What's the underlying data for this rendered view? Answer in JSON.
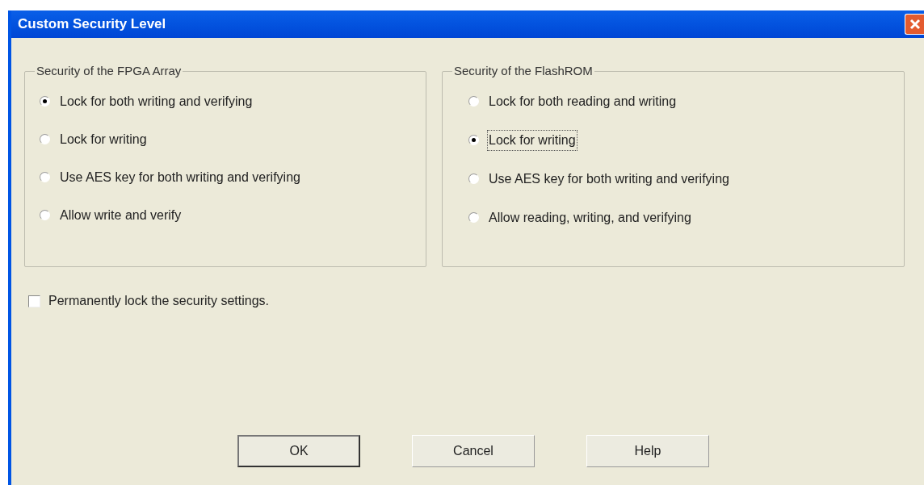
{
  "window": {
    "title": "Custom Security Level"
  },
  "groups": [
    {
      "title": "Security of the FPGA Array",
      "options": [
        {
          "label": "Lock for both writing and verifying",
          "selected": true,
          "focused": false
        },
        {
          "label": "Lock for writing",
          "selected": false,
          "focused": false
        },
        {
          "label": "Use AES key for both writing and verifying",
          "selected": false,
          "focused": false
        },
        {
          "label": "Allow write and verify",
          "selected": false,
          "focused": false
        }
      ]
    },
    {
      "title": "Security of the FlashROM",
      "options": [
        {
          "label": "Lock for both reading and writing",
          "selected": false,
          "focused": false
        },
        {
          "label": "Lock for writing",
          "selected": true,
          "focused": true
        },
        {
          "label": "Use AES key for both writing and verifying",
          "selected": false,
          "focused": false
        },
        {
          "label": "Allow reading, writing, and verifying",
          "selected": false,
          "focused": false
        }
      ]
    }
  ],
  "permanent_lock": {
    "label": "Permanently lock the security settings.",
    "checked": false
  },
  "buttons": [
    {
      "label": "OK",
      "default": true
    },
    {
      "label": "Cancel",
      "default": false
    },
    {
      "label": "Help",
      "default": false
    }
  ]
}
